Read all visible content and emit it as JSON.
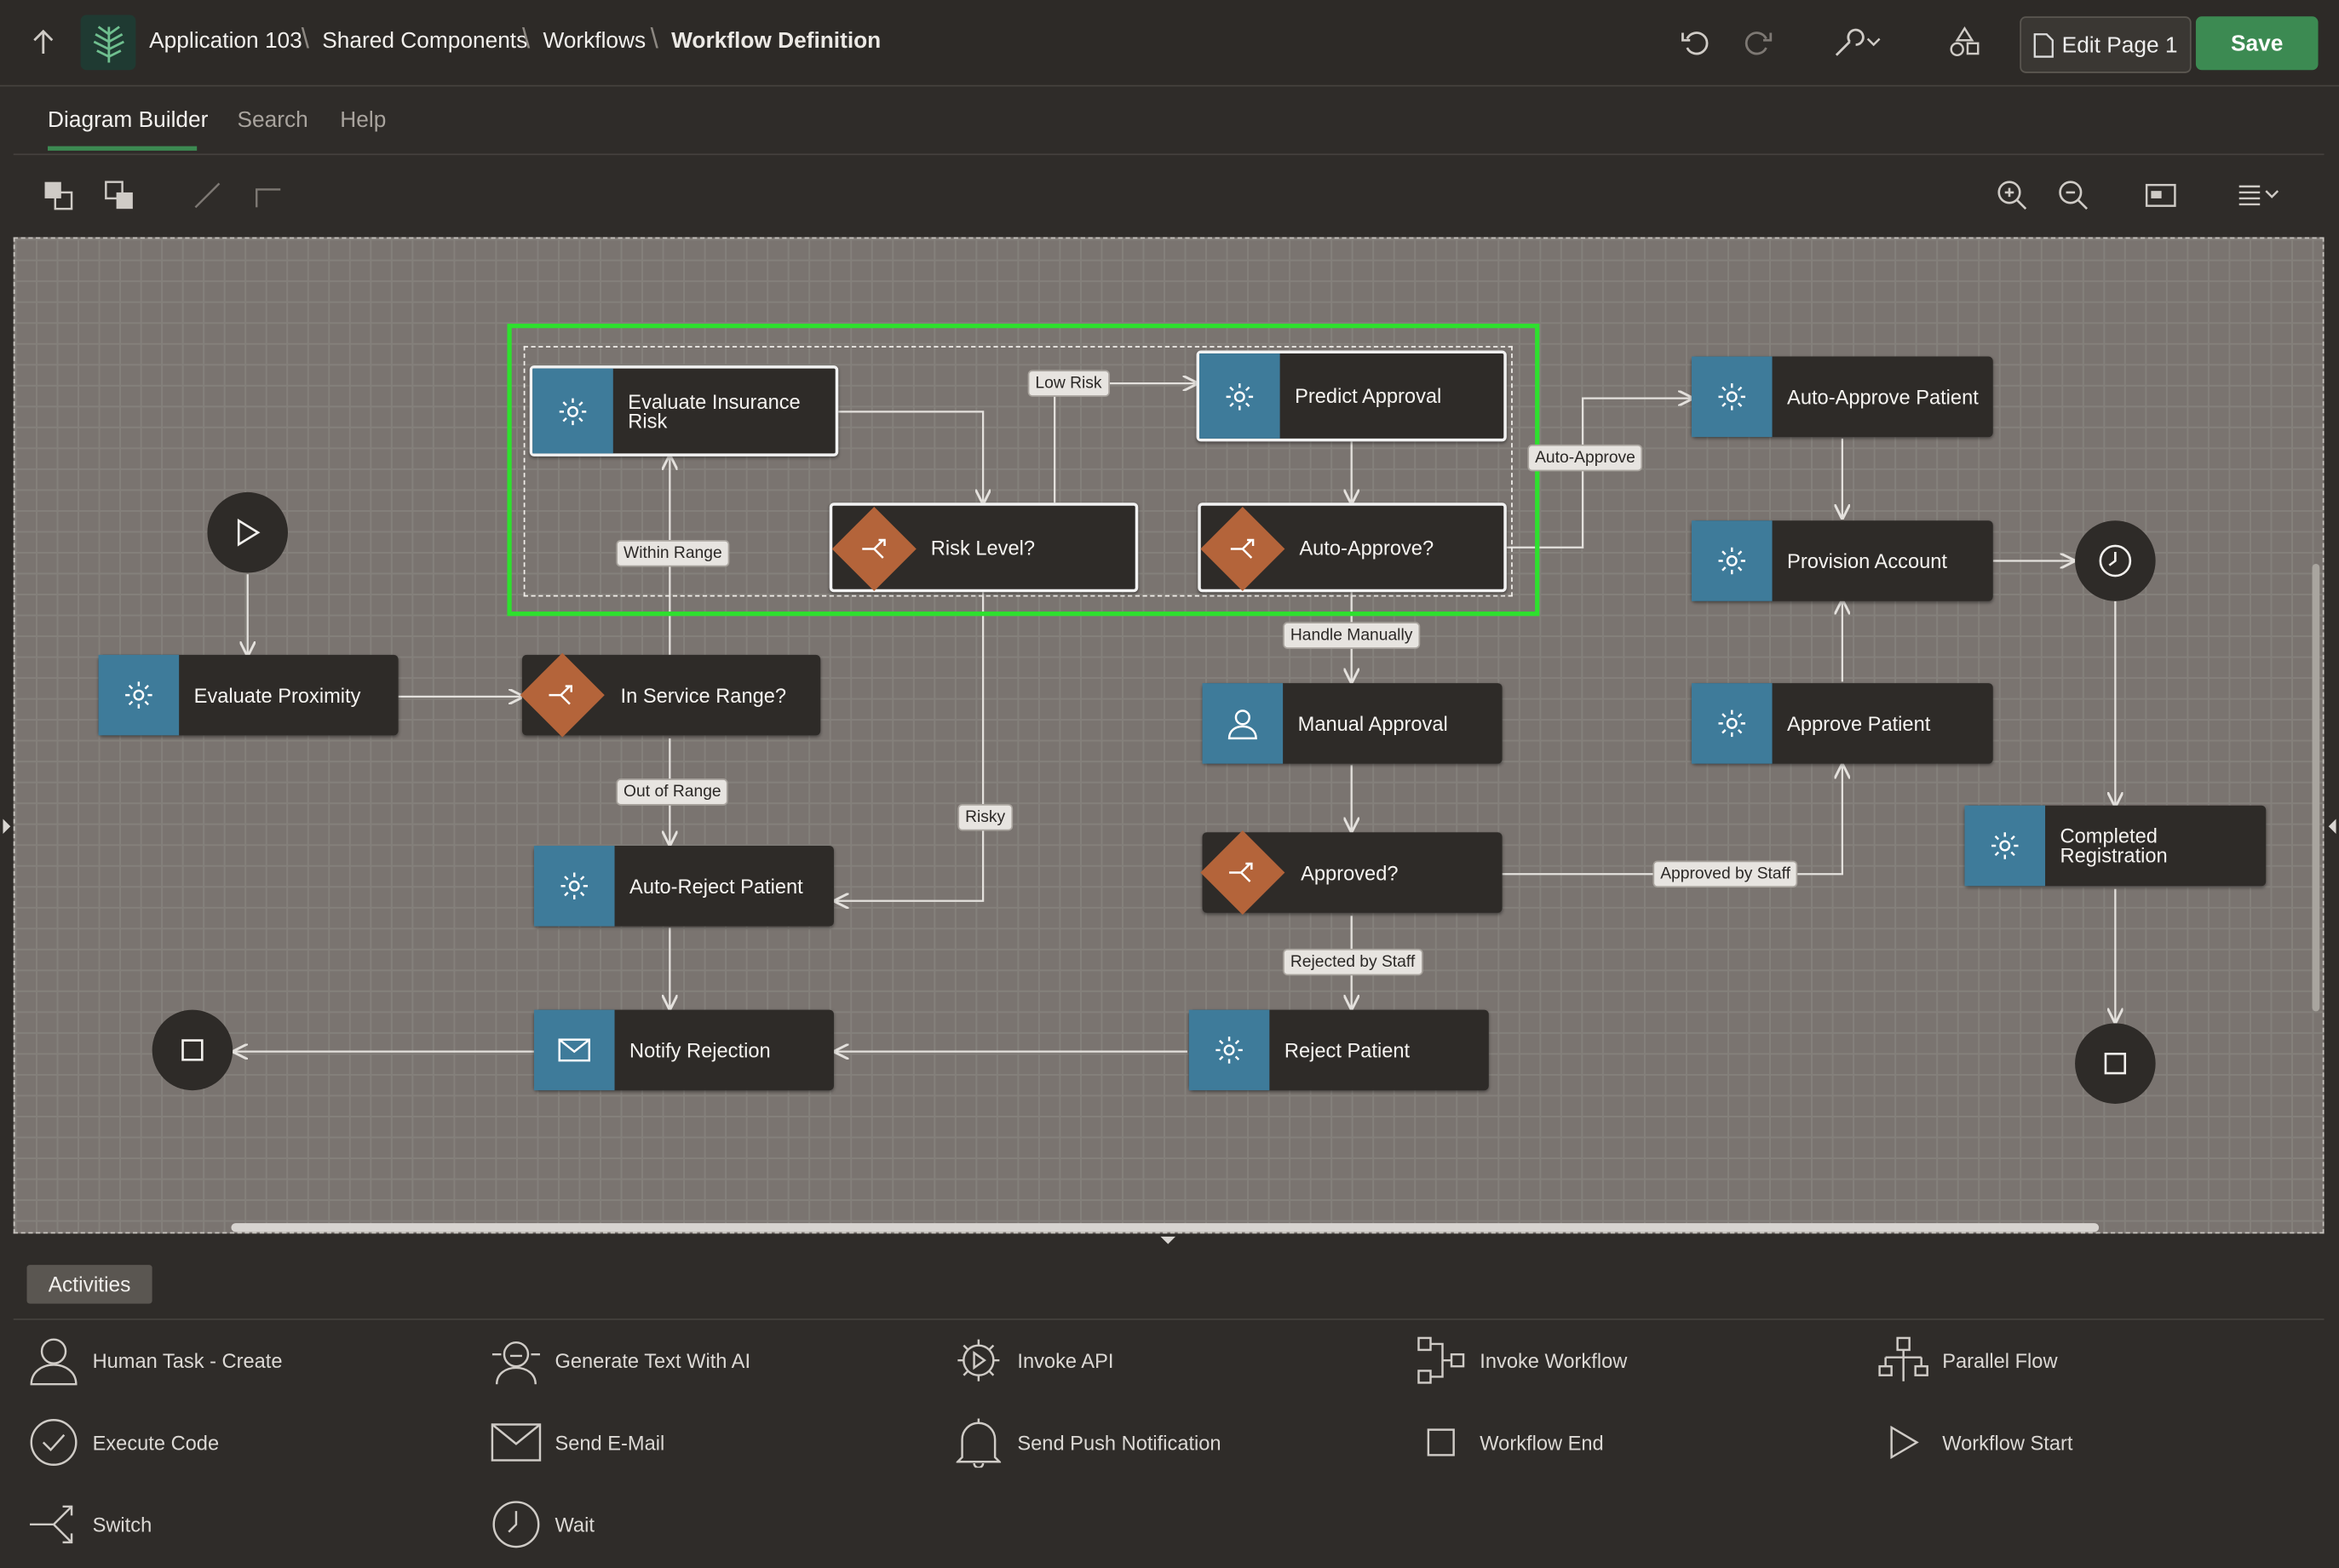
{
  "breadcrumb": {
    "app": "Application 103",
    "shared": "Shared Components",
    "workflows": "Workflows",
    "current": "Workflow Definition"
  },
  "header": {
    "edit_page": "Edit Page 1",
    "save": "Save"
  },
  "tabs": [
    "Diagram Builder",
    "Search",
    "Help"
  ],
  "nodes": {
    "evaluate_insurance_risk": "Evaluate Insurance Risk",
    "risk_level": "Risk Level?",
    "predict_approval": "Predict Approval",
    "auto_approve_q": "Auto-Approve?",
    "auto_approve_patient": "Auto-Approve Patient",
    "provision_account": "Provision Account",
    "approve_patient": "Approve Patient",
    "completed_registration": "Completed Registration",
    "evaluate_proximity": "Evaluate Proximity",
    "in_service_range": "In Service Range?",
    "manual_approval": "Manual Approval",
    "approved_q": "Approved?",
    "auto_reject_patient": "Auto-Reject Patient",
    "notify_rejection": "Notify Rejection",
    "reject_patient": "Reject Patient"
  },
  "edge_labels": {
    "low_risk": "Low Risk",
    "within_range": "Within Range",
    "auto_approve": "Auto-Approve",
    "handle_manually": "Handle Manually",
    "out_of_range": "Out of Range",
    "risky": "Risky",
    "approved_by_staff": "Approved by Staff",
    "rejected_by_staff": "Rejected by Staff"
  },
  "activities_tab": "Activities",
  "activities": {
    "human_task": "Human Task - Create",
    "generate_text": "Generate Text With AI",
    "invoke_api": "Invoke API",
    "invoke_workflow": "Invoke Workflow",
    "parallel_flow": "Parallel Flow",
    "execute_code": "Execute Code",
    "send_email": "Send E-Mail",
    "send_push": "Send Push Notification",
    "workflow_end": "Workflow End",
    "workflow_start": "Workflow Start",
    "switch": "Switch",
    "wait": "Wait"
  },
  "colors": {
    "accent_green": "#3c8a52",
    "service_blue": "#3e7b9a",
    "switch_orange": "#b4643a",
    "selection_green": "#2ee02e"
  },
  "icons": [
    "up-arrow-icon",
    "app-logo-icon",
    "undo-icon",
    "redo-icon",
    "wrench-icon",
    "shapes-icon",
    "page-icon",
    "gear-icon",
    "play-icon",
    "stop-icon",
    "clock-icon",
    "user-icon",
    "mail-icon",
    "branch-icon",
    "zoom-in-icon",
    "zoom-out-icon",
    "fit-icon",
    "menu-icon"
  ]
}
